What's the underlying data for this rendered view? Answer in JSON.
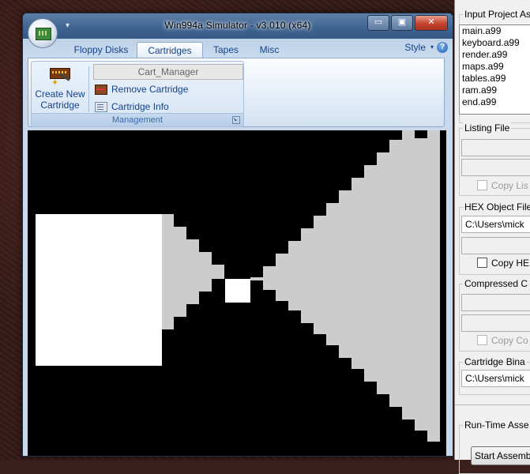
{
  "window": {
    "title": "Win994a Simulator - v3.010 (x64)",
    "qat_glyph": "▾",
    "min_glyph": "▭",
    "max_glyph": "▣",
    "close_glyph": "✕"
  },
  "ribbon": {
    "tabs": [
      {
        "label": "Floppy Disks"
      },
      {
        "label": "Cartridges"
      },
      {
        "label": "Tapes"
      },
      {
        "label": "Misc"
      }
    ],
    "active_tab": "Cartridges",
    "style_label": "Style",
    "style_arrow": "▾",
    "help_glyph": "?",
    "group": {
      "label": "Management",
      "create_label_1": "Create New",
      "create_label_2": "Cartridge",
      "cart_name": "Cart_Manager",
      "remove_label": "Remove Cartridge",
      "info_label": "Cartridge Info",
      "launcher_glyph": "↘"
    }
  },
  "screen": {
    "background": "#000000",
    "bright": "#ffffff",
    "shade": "#cccccc"
  },
  "assembler": {
    "input_legend": "Input Project As",
    "files": [
      "main.a99",
      "keyboard.a99",
      "render.a99",
      "maps.a99",
      "tables.a99",
      "ram.a99",
      "end.a99"
    ],
    "listing_legend": "Listing File",
    "listing_copy": "Copy Lis",
    "hex_legend": "HEX Object File",
    "hex_path": "C:\\Users\\mick",
    "hex_copy": "Copy HE",
    "compressed_legend": "Compressed C",
    "compressed_copy": "Copy Co",
    "cart_bin_legend": "Cartridge Bina",
    "cart_bin_path": "C:\\Users\\mick",
    "runtime_legend": "Run-Time Asse",
    "start_button": "Start Assemb"
  }
}
